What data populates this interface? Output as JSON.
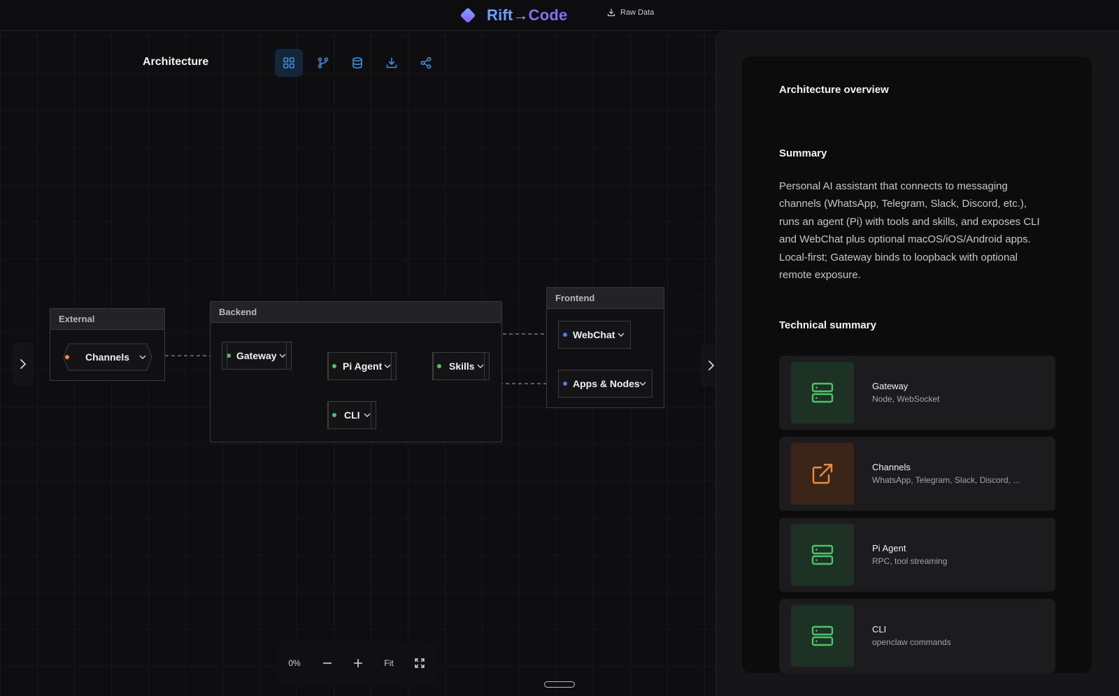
{
  "header": {
    "brand_left": "Rift",
    "brand_arrow": "→",
    "brand_right": "Code",
    "raw_data_label": "Raw Data"
  },
  "canvas": {
    "title": "Architecture",
    "toolbar": [
      {
        "icon": "grid-icon",
        "active": true
      },
      {
        "icon": "git-branch-icon",
        "active": false
      },
      {
        "icon": "database-icon",
        "active": false
      },
      {
        "icon": "download-icon",
        "active": false
      },
      {
        "icon": "share-icon",
        "active": false
      }
    ],
    "groups": {
      "external": "External",
      "backend": "Backend",
      "frontend": "Frontend"
    },
    "nodes": {
      "channels": "Channels",
      "gateway": "Gateway",
      "pi_agent": "Pi Agent",
      "skills": "Skills",
      "cli": "CLI",
      "webchat": "WebChat",
      "apps_nodes": "Apps & Nodes"
    },
    "colors": {
      "external_dot": "#f08a3c",
      "backend_dot": "#4cc46a",
      "frontend_dot": "#4b7cf3",
      "accent": "#3b8fe0"
    },
    "zoom": {
      "percent": "0%",
      "fit_label": "Fit"
    }
  },
  "panel": {
    "overview_title": "Architecture overview",
    "summary_title": "Summary",
    "summary_text": "Personal AI assistant that connects to messaging channels (WhatsApp, Telegram, Slack, Discord, etc.), runs an agent (Pi) with tools and skills, and exposes CLI and WebChat plus optional macOS/iOS/Android apps. Local-first; Gateway binds to loopback with optional remote exposure.",
    "technical_title": "Technical summary",
    "tech_items": [
      {
        "name": "Gateway",
        "detail": "Node, WebSocket",
        "icon": "server-icon",
        "color": "#4cc46a"
      },
      {
        "name": "Channels",
        "detail": "WhatsApp, Telegram, Slack, Discord, ...",
        "icon": "external-link-icon",
        "color": "#f08a3c"
      },
      {
        "name": "Pi Agent",
        "detail": "RPC, tool streaming",
        "icon": "server-icon",
        "color": "#4cc46a"
      },
      {
        "name": "CLI",
        "detail": "openclaw commands",
        "icon": "server-icon",
        "color": "#4cc46a"
      }
    ]
  }
}
